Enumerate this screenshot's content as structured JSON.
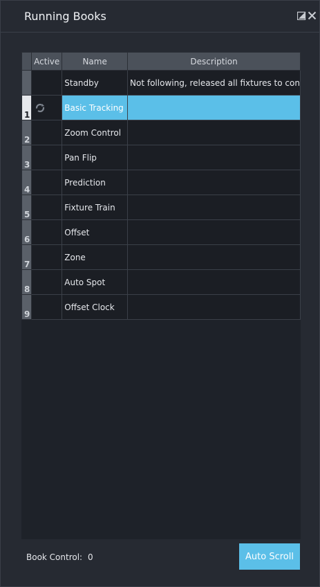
{
  "window": {
    "title": "Running Books"
  },
  "table": {
    "columns": [
      "",
      "Active",
      "Name",
      "Description"
    ],
    "rows": [
      {
        "num": "",
        "name": "Standby",
        "description": "Not following, released all fixtures to con"
      },
      {
        "num": "1",
        "name": "Basic Tracking",
        "description": "",
        "active": true,
        "selected": true
      },
      {
        "num": "2",
        "name": "Zoom Control",
        "description": ""
      },
      {
        "num": "3",
        "name": "Pan Flip",
        "description": ""
      },
      {
        "num": "4",
        "name": "Prediction",
        "description": ""
      },
      {
        "num": "5",
        "name": "Fixture Train",
        "description": ""
      },
      {
        "num": "6",
        "name": "Offset",
        "description": ""
      },
      {
        "num": "7",
        "name": "Zone",
        "description": ""
      },
      {
        "num": "8",
        "name": "Auto Spot",
        "description": ""
      },
      {
        "num": "9",
        "name": "Offset Clock",
        "description": ""
      }
    ]
  },
  "footer": {
    "book_control_label": "Book Control:",
    "book_control_value": "0",
    "auto_scroll_label": "Auto Scroll"
  },
  "icons": {
    "active": "sync-icon",
    "maximize": "maximize-icon",
    "close": "close-icon"
  },
  "colors": {
    "accent": "#5bbfe8",
    "background": "#262a32"
  }
}
